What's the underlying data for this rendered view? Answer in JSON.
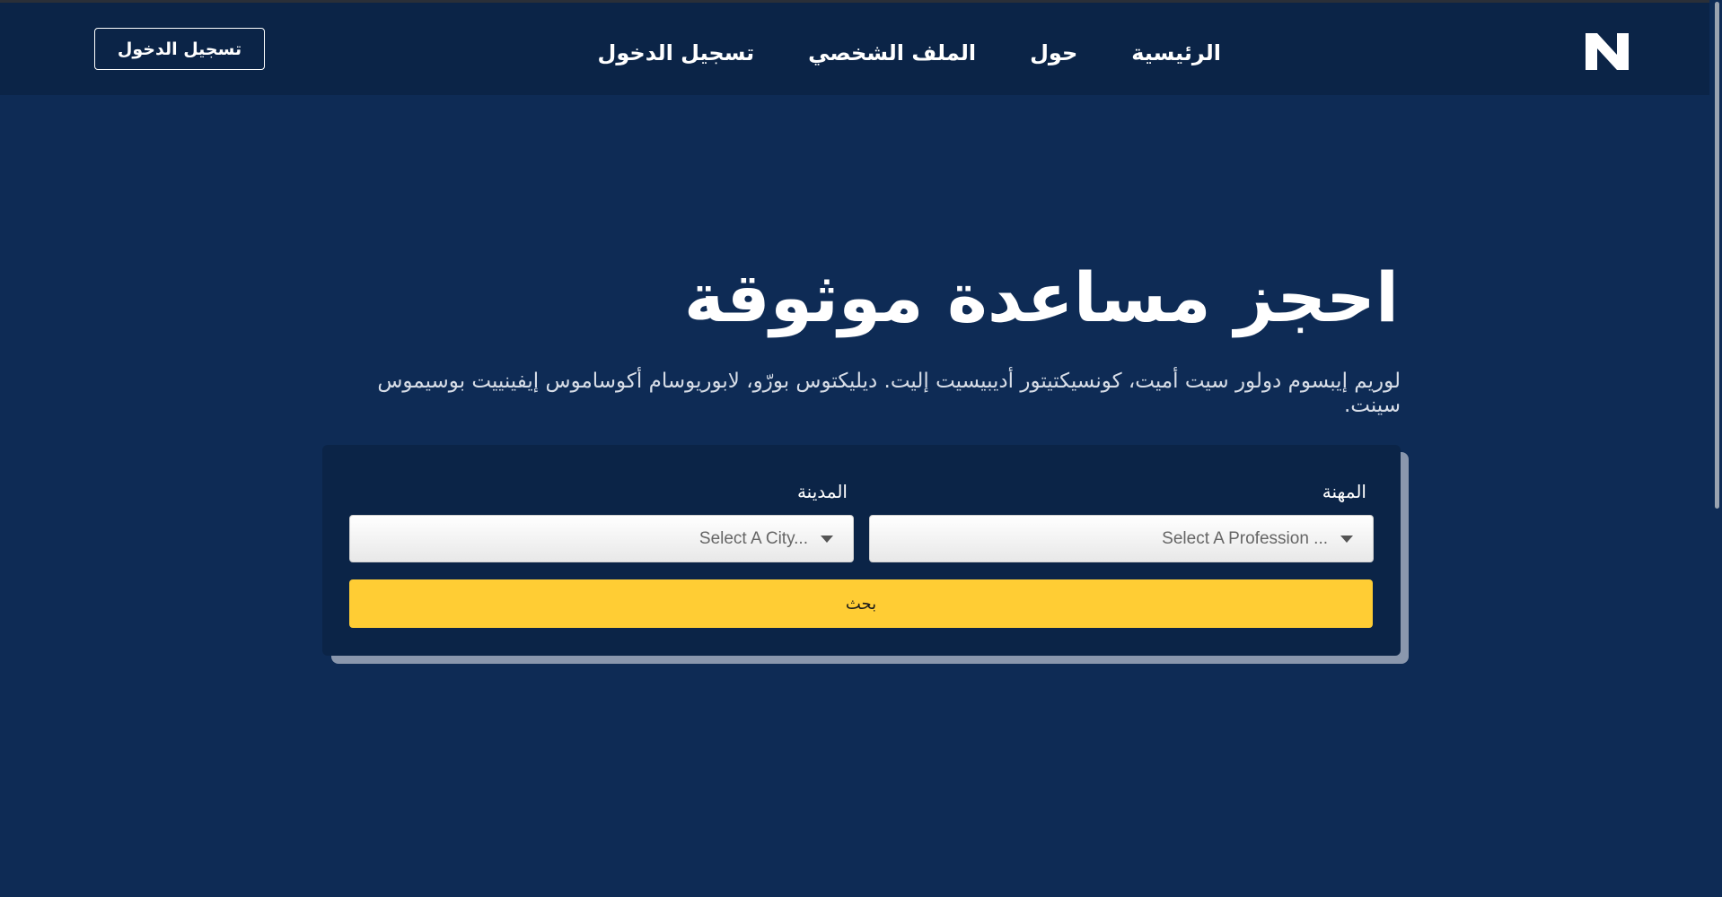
{
  "header": {
    "logo_letter": "N",
    "nav": [
      {
        "label": "الرئيسية"
      },
      {
        "label": "حول"
      },
      {
        "label": "الملف الشخصي"
      },
      {
        "label": "تسجيل الدخول"
      }
    ],
    "login_button": "تسجيل الدخول"
  },
  "hero": {
    "title": "احجز مساعدة موثوقة",
    "subtitle": "لوريم إيبسوم دولور سيت أميت، كونسيكتيتور أديبيسيت إليت. ديليكتوس بورّو، لابوريوسام أكوساموس إيفينييت بوسيموس سينت."
  },
  "search_form": {
    "profession_label": "المهنة",
    "profession_placeholder": "Select A Profession ...",
    "city_label": "المدينة",
    "city_placeholder": "Select A City...",
    "search_button": "بحث"
  },
  "colors": {
    "page_bg": "#0e2b55",
    "header_bg": "#0b2447",
    "accent": "#ffcd34"
  }
}
